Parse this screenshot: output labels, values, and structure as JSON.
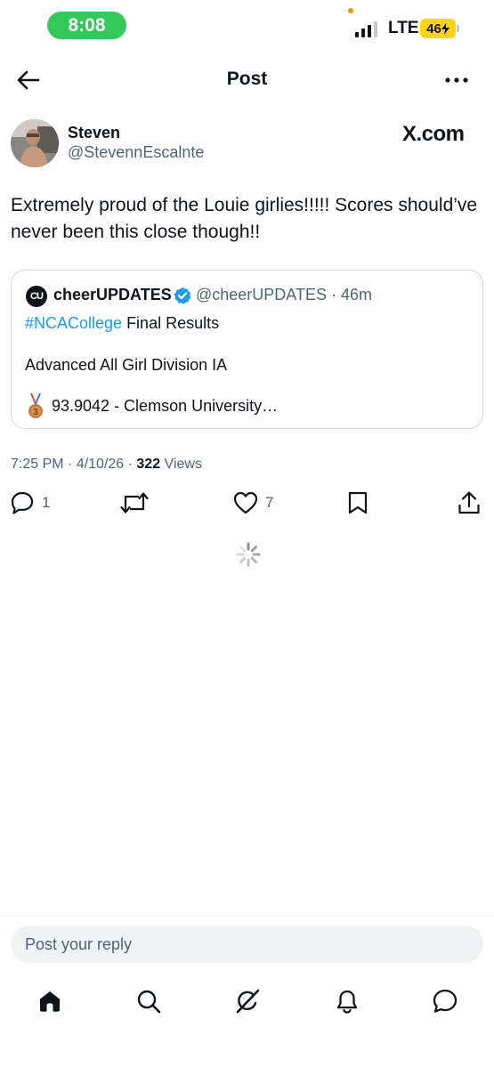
{
  "status_bar": {
    "time": "8:08",
    "network": "LTE",
    "battery": "46",
    "colors": {
      "time_pill": "#34c759",
      "battery": "#ffd60a",
      "privacy_dot": "#ff9500"
    }
  },
  "header": {
    "title": "Post",
    "back_icon": "arrow-left-icon",
    "more_icon": "ellipsis-icon"
  },
  "post": {
    "author_name": "Steven",
    "author_handle": "@StevennEscalnte",
    "source_wordmark": "X.com",
    "text": "Extremely proud of the Louie girlies!!!!! Scores should’ve never been this close though!!",
    "quote": {
      "avatar_text": "CU",
      "name": "cheerUPDATES",
      "handle_time": "@cheerUPDATES · 46m",
      "hashtag": "#NCACollege",
      "line1_rest": " Final Results",
      "line2": "Advanced All Girl Division IA",
      "line3": "93.9042 - Clemson University…",
      "medal_icon": "third-place-medal-icon"
    },
    "meta_prefix": "7:25 PM · 4/10/26 · ",
    "views_count": "322",
    "views_label": " Views"
  },
  "actions": {
    "reply_count": "1",
    "like_count": "7"
  },
  "reply": {
    "placeholder": "Post your reply"
  },
  "tabbar": {
    "items": [
      "home-icon",
      "search-icon",
      "grok-icon",
      "notifications-icon",
      "messages-icon"
    ]
  },
  "colors": {
    "accent": "#1d9bf0",
    "text": "#0f1419",
    "secondary": "#536471",
    "border": "#cfd9de"
  }
}
